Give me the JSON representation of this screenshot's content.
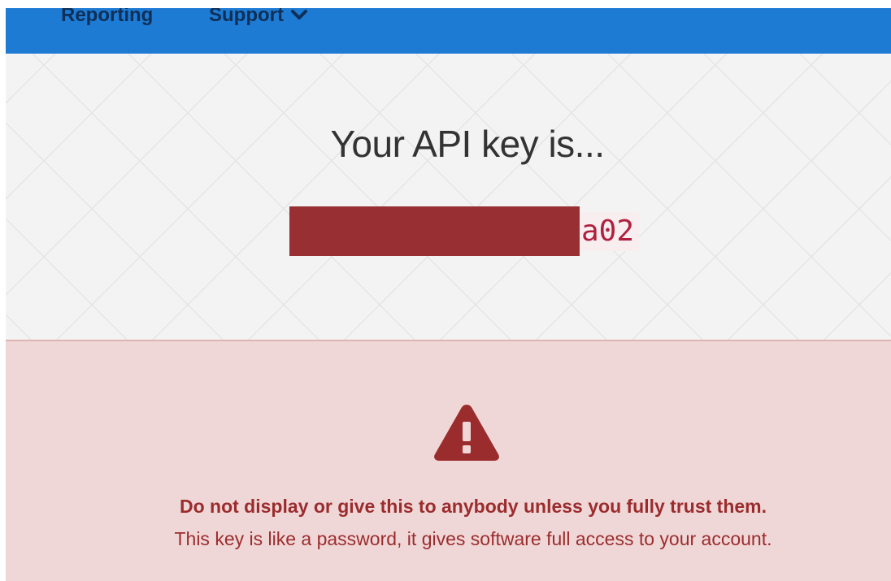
{
  "nav": {
    "items": [
      {
        "label": "Reporting"
      },
      {
        "label": "Support",
        "has_dropdown": true,
        "icon": "chevron-down-icon"
      }
    ]
  },
  "hero": {
    "title": "Your API key is...",
    "key": {
      "visible_suffix": "a02",
      "prefix_redacted": true
    }
  },
  "warning": {
    "icon": "warning-triangle-icon",
    "strong_text": "Do not display or give this to anybody unless you fully trust them.",
    "text": "This key is like a password, it gives software full access to your account."
  },
  "colors": {
    "navbar": "#1e7bd3",
    "nav_text": "#0e2f57",
    "hero_background": "#f3f3f3",
    "redaction": "#983033",
    "key_text": "#b0203e",
    "warning_background": "#f0d7d7",
    "warning_text": "#9b2c2e"
  }
}
